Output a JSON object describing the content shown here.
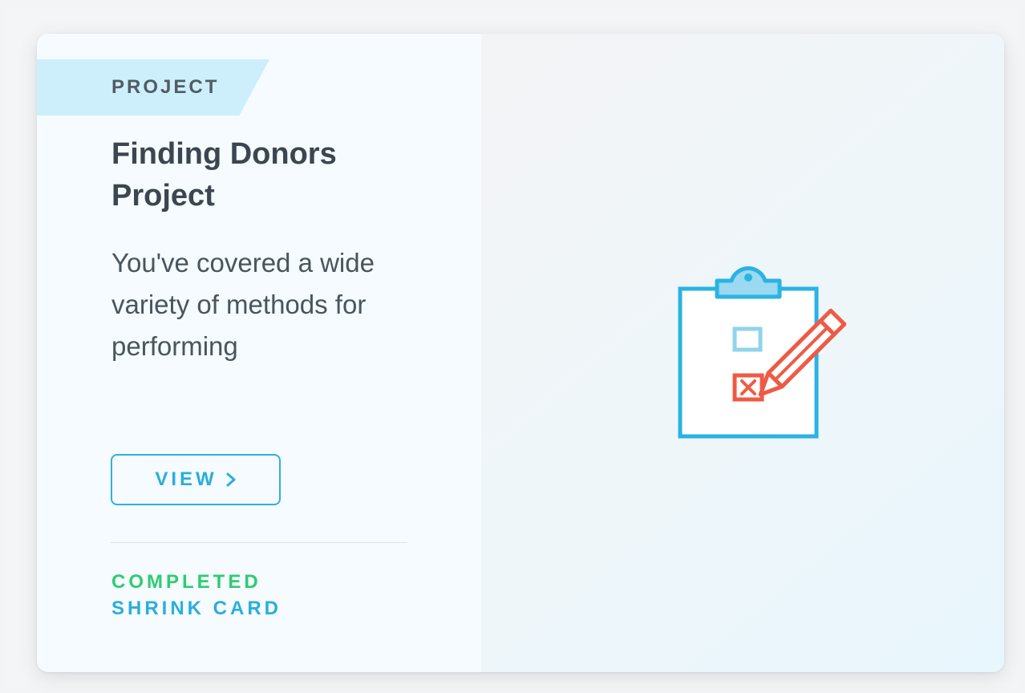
{
  "card": {
    "tag": "PROJECT",
    "title": "Finding Donors Project",
    "description": "You've covered a wide variety of methods for performing",
    "view_label": "VIEW",
    "status": "COMPLETED",
    "shrink_label": "SHRINK CARD",
    "illustration": "clipboard-checklist-pencil-icon"
  },
  "colors": {
    "accent": "#2aaedc",
    "completed": "#2ecc71",
    "ribbon": "#cdeffb",
    "pencil": "#ef5a45"
  }
}
